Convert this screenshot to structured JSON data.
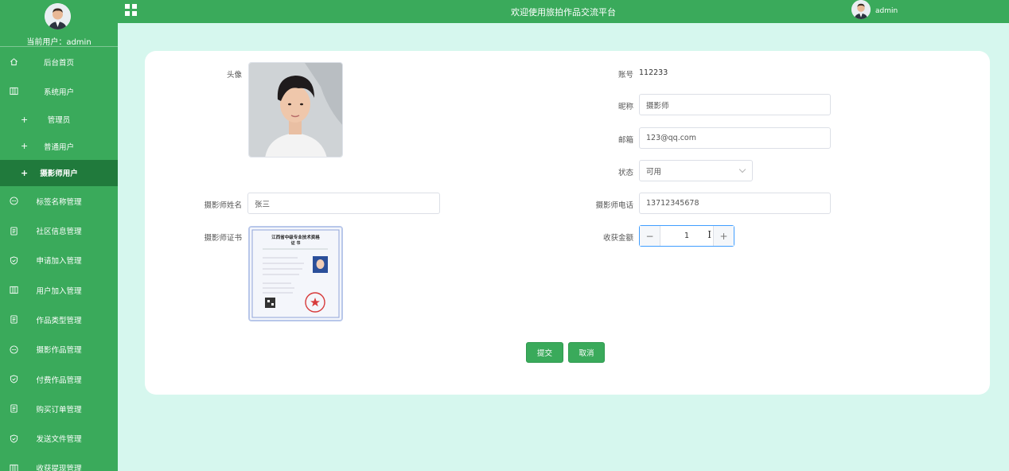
{
  "sidebar": {
    "current_user_label": "当前用户：admin",
    "items": [
      {
        "label": "后台首页",
        "icon": "home-icon"
      },
      {
        "label": "系统用户",
        "icon": "columns-icon"
      },
      {
        "label": "管理员",
        "icon": "plus-icon"
      },
      {
        "label": "普通用户",
        "icon": "plus-icon"
      },
      {
        "label": "摄影师用户",
        "icon": "plus-icon"
      },
      {
        "label": "标签名称管理",
        "icon": "chat-icon"
      },
      {
        "label": "社区信息管理",
        "icon": "document-icon"
      },
      {
        "label": "申请加入管理",
        "icon": "shield-icon"
      },
      {
        "label": "用户加入管理",
        "icon": "columns-icon"
      },
      {
        "label": "作品类型管理",
        "icon": "document-icon"
      },
      {
        "label": "摄影作品管理",
        "icon": "chat-icon"
      },
      {
        "label": "付费作品管理",
        "icon": "shield-icon"
      },
      {
        "label": "购买订单管理",
        "icon": "document-icon"
      },
      {
        "label": "发送文件管理",
        "icon": "shield-icon"
      },
      {
        "label": "收获提现管理",
        "icon": "columns-icon"
      }
    ]
  },
  "topbar": {
    "title": "欢迎使用旅拍作品交流平台",
    "username": "admin"
  },
  "form": {
    "avatar_label": "头像",
    "account_label": "账号",
    "account_value": "112233",
    "nickname_label": "昵称",
    "nickname_value": "摄影师",
    "email_label": "邮箱",
    "email_value": "123@qq.com",
    "status_label": "状态",
    "status_value": "可用",
    "name_label": "摄影师姓名",
    "name_value": "张三",
    "phone_label": "摄影师电话",
    "phone_value": "13712345678",
    "cert_label": "摄影师证书",
    "amount_label": "收获金额",
    "amount_value": "1",
    "stepper_minus": "−",
    "stepper_plus": "+",
    "cert_title": "江西省中级专业技术资格",
    "cert_subtitle": "证 书"
  },
  "actions": {
    "submit_label": "提交",
    "cancel_label": "取消"
  },
  "colors": {
    "brand_green": "#3aaa5b",
    "active_green": "#207a3c",
    "page_bg": "#d6f7ee"
  }
}
